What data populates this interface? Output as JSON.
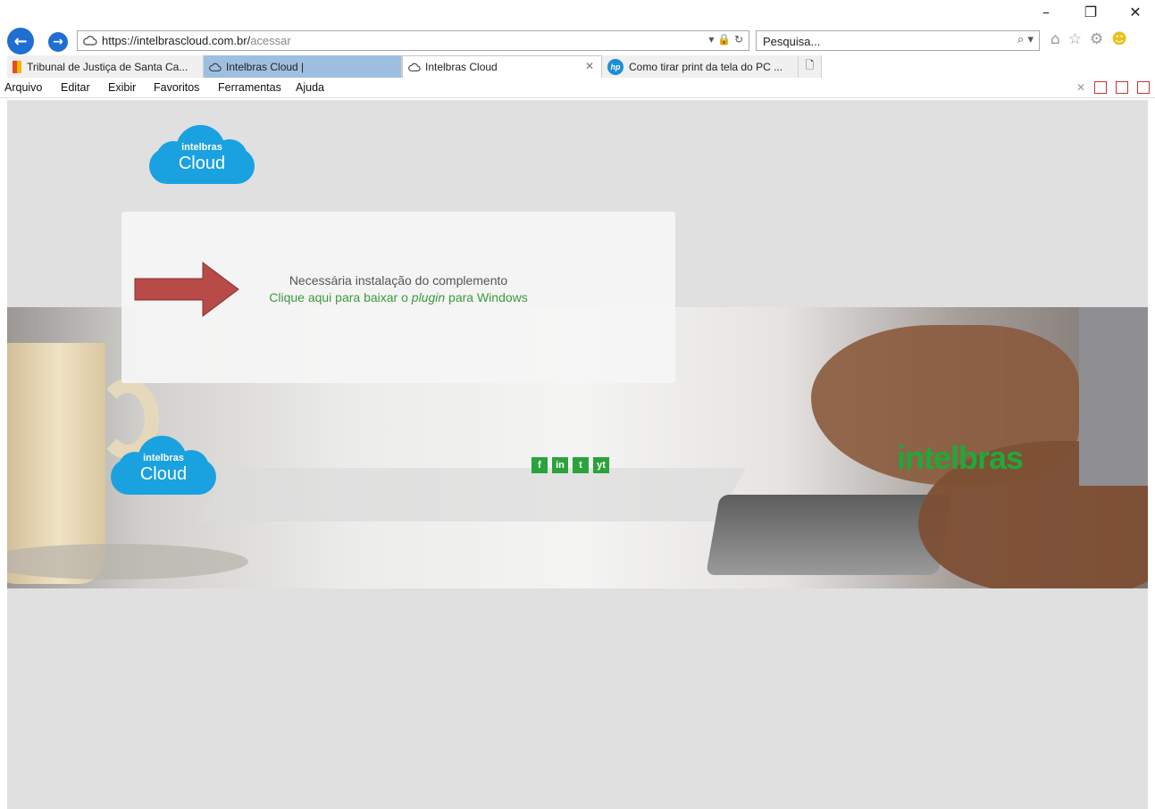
{
  "window": {
    "minimize_icon": "–",
    "restore_icon": "❐",
    "close_icon": "✕"
  },
  "nav": {
    "back_icon": "←",
    "forward_icon": "→",
    "url_base": "https://intelbrascloud.com.br/",
    "url_path": "acessar",
    "address_tools": "▾ 🔒 ↻",
    "search_placeholder": "Pesquisa...",
    "search_icon": "⌕ ▾"
  },
  "toolbar": {
    "home_icon": "⌂",
    "favorites_icon": "☆",
    "settings_icon": "⚙",
    "feedback_icon": "☻"
  },
  "tabs": [
    {
      "label": "Tribunal de Justiça de Santa Ca..."
    },
    {
      "label": "Intelbras Cloud |"
    },
    {
      "label": "Intelbras Cloud",
      "close": "✕"
    },
    {
      "label": "Como tirar print da tela do PC ...",
      "icon_text": "hp"
    }
  ],
  "new_tab_icon": "🗋",
  "menu": {
    "items": [
      "Arquivo",
      "Editar",
      "Exibir",
      "Favoritos",
      "Ferramentas",
      "Ajuda"
    ],
    "close_icon": "✕"
  },
  "page": {
    "logo_small": "intelbras",
    "logo_big": "Cloud",
    "message": "Necessária instalação do complemento",
    "link_before": "Clique aqui para baixar o ",
    "link_em": "plugin",
    "link_after": " para Windows",
    "social": [
      "f",
      "in",
      "t",
      "yt"
    ],
    "wordmark": "intelbras"
  },
  "colors": {
    "accent_blue": "#1aa1e0",
    "brand_green": "#20a83a",
    "arrow_red": "#b84a48"
  }
}
